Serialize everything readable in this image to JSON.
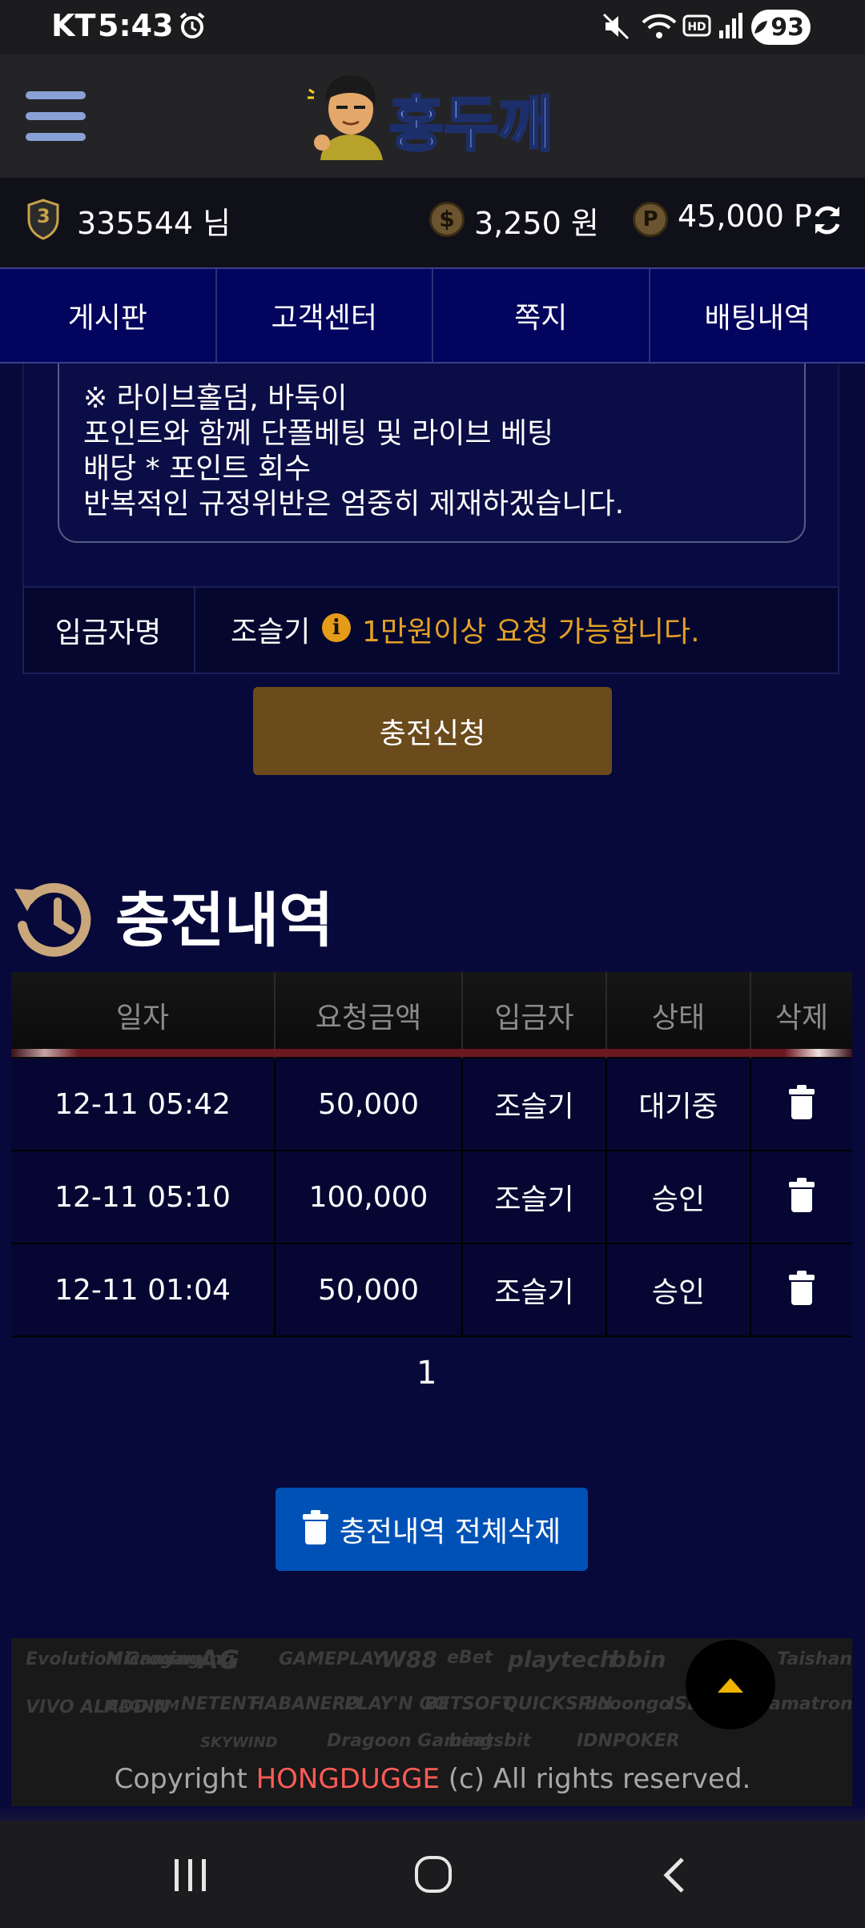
{
  "status_bar": {
    "carrier": "KT",
    "time": "5:43",
    "battery": "93"
  },
  "header": {
    "logo_text": "홍두깨"
  },
  "user_bar": {
    "level": "3",
    "username": "335544 님",
    "money": "3,250 원",
    "points": "45,000 P"
  },
  "nav_tabs": [
    {
      "label": "게시판"
    },
    {
      "label": "고객센터"
    },
    {
      "label": "쪽지"
    },
    {
      "label": "배팅내역"
    }
  ],
  "notice": {
    "lines": [
      "※ 라이브홀덤, 바둑이",
      "포인트와 함께 단폴베팅 및 라이브 베팅",
      "배당 * 포인트 회수",
      "반복적인 규정위반은 엄중히 제재하겠습니다."
    ]
  },
  "depositor": {
    "label": "입금자명",
    "name": "조슬기",
    "note": "1만원이상 요청 가능합니다."
  },
  "charge_button": "충전신청",
  "history": {
    "title": "충전내역",
    "columns": [
      "일자",
      "요청금액",
      "입금자",
      "상태",
      "삭제"
    ],
    "rows": [
      {
        "date": "12-11 05:42",
        "amount": "50,000",
        "depositor": "조슬기",
        "status": "대기중"
      },
      {
        "date": "12-11 05:10",
        "amount": "100,000",
        "depositor": "조슬기",
        "status": "승인"
      },
      {
        "date": "12-11 01:04",
        "amount": "50,000",
        "depositor": "조슬기",
        "status": "승인"
      }
    ],
    "page": "1",
    "delete_all": "충전내역 전체삭제"
  },
  "footer": {
    "logos": [
      "Evolution Gaming",
      "Microgaming",
      "AG",
      "GAMEPLAY",
      "W88",
      "eBet",
      "playtech",
      "bbin",
      "Taishan",
      "VIVO ALADDIN",
      "MAGNUM",
      "NETENT",
      "HABANERO",
      "PLAY'N GO",
      "BETSOFT",
      "QUICKSPIN",
      "booongo",
      "ISB",
      "amatron",
      "SKYWIND",
      "Dragoon Gaming",
      "beatsbit",
      "IDNPOKER"
    ],
    "copyright_prefix": "Copyright ",
    "copyright_brand": "HONGDUGGE",
    "copyright_suffix": " (c) All rights reserved."
  },
  "colors": {
    "background": "#07093a",
    "charge_button": "#6b4a1b",
    "delete_all_button": "#0051b5",
    "note_orange": "#e5a125",
    "brand_red": "#ff5b57"
  }
}
